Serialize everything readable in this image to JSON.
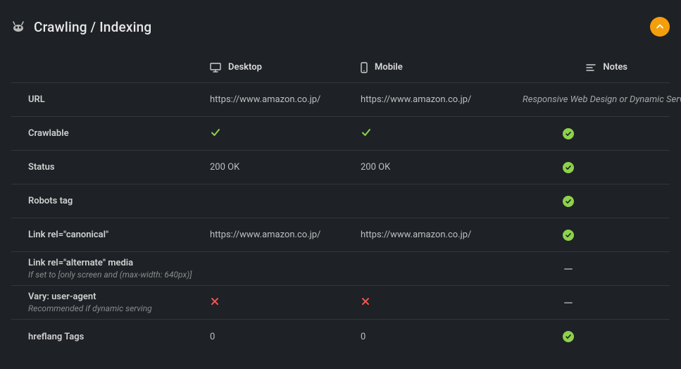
{
  "header": {
    "title": "Crawling / Indexing"
  },
  "columns": {
    "desktop": "Desktop",
    "mobile": "Mobile",
    "notes": "Notes"
  },
  "rows": {
    "url": {
      "label": "URL",
      "desktop": "https://www.amazon.co.jp/",
      "mobile": "https://www.amazon.co.jp/",
      "note": "Responsive Web Design or Dynamic Servi"
    },
    "crawlable": {
      "label": "Crawlable",
      "desktop": "check",
      "mobile": "check",
      "note": "badge-check"
    },
    "status": {
      "label": "Status",
      "desktop": "200 OK",
      "mobile": "200 OK",
      "note": "badge-check"
    },
    "robots": {
      "label": "Robots tag",
      "desktop": "",
      "mobile": "",
      "note": "badge-check"
    },
    "canonical": {
      "label": "Link rel=\"canonical\"",
      "desktop": "https://www.amazon.co.jp/",
      "mobile": "https://www.amazon.co.jp/",
      "note": "badge-check"
    },
    "alternate": {
      "label": "Link rel=\"alternate\" media",
      "sub": "If set to [only screen and (max-width: 640px)]",
      "desktop": "",
      "mobile": "",
      "note": "dash"
    },
    "vary": {
      "label": "Vary: user-agent",
      "sub": "Recommended if dynamic serving",
      "desktop": "cross",
      "mobile": "cross",
      "note": "dash"
    },
    "hreflang": {
      "label": "hreflang Tags",
      "desktop": "0",
      "mobile": "0",
      "note": "badge-check"
    }
  }
}
